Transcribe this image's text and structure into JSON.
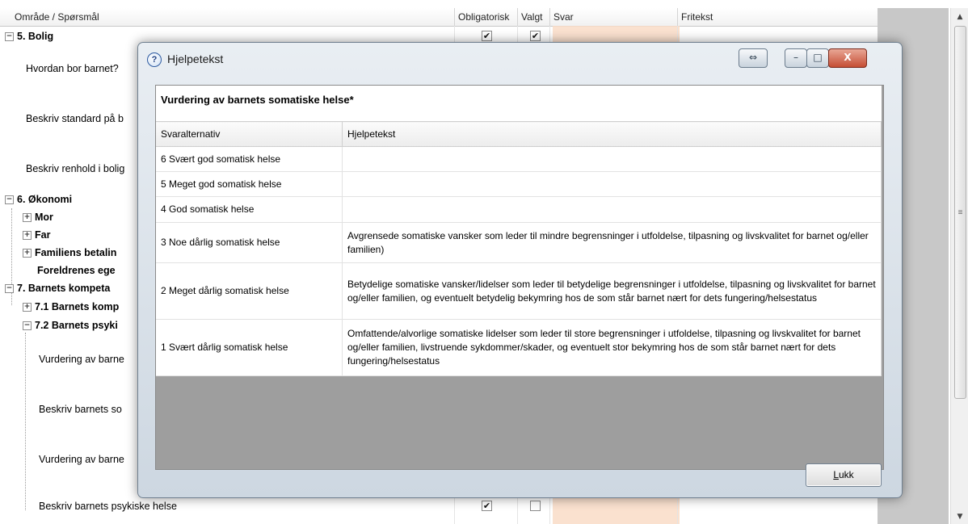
{
  "grid": {
    "columns": [
      "Område / Spørsmål",
      "Obligatorisk",
      "Valgt",
      "Svar",
      "Fritekst"
    ],
    "rows": [
      {
        "label": "5. Bolig",
        "bold": true,
        "toggle": "−"
      },
      {
        "label": "Hvordan bor barnet?"
      },
      {
        "label": "Beskriv standard på b"
      },
      {
        "label": "Beskriv renhold i bolig"
      },
      {
        "label": "6. Økonomi",
        "bold": true,
        "toggle": "−"
      },
      {
        "label": "Mor",
        "bold": true,
        "toggle": "+"
      },
      {
        "label": "Far",
        "bold": true,
        "toggle": "+"
      },
      {
        "label": "Familiens betalin",
        "bold": true,
        "toggle": "+"
      },
      {
        "label": "Foreldrenes ege",
        "bold": true
      },
      {
        "label": "7. Barnets kompeta",
        "bold": true,
        "toggle": "−"
      },
      {
        "label": "7.1 Barnets komp",
        "bold": true,
        "toggle": "+"
      },
      {
        "label": "7.2 Barnets psyki",
        "bold": true,
        "toggle": "−"
      },
      {
        "label": "Vurdering av barne"
      },
      {
        "label": "Beskriv barnets so"
      },
      {
        "label": "Vurdering av barne"
      },
      {
        "label": "Beskriv barnets psykiske helse"
      }
    ]
  },
  "dialog": {
    "title": "Hjelpetekst",
    "heading": "Vurdering av barnets somatiske helse*",
    "table_headers": [
      "Svaralternativ",
      "Hjelpetekst"
    ],
    "table_rows": [
      {
        "option": "6 Svært god somatisk helse",
        "help": ""
      },
      {
        "option": "5 Meget god somatisk helse",
        "help": ""
      },
      {
        "option": "4 God somatisk helse",
        "help": ""
      },
      {
        "option": "3 Noe dårlig somatisk helse",
        "help": "Avgrensede somatiske vansker som leder til mindre begrensninger i utfoldelse, tilpasning og livskvalitet for barnet og/eller familien)"
      },
      {
        "option": "2 Meget dårlig somatisk helse",
        "help": "Betydelige somatiske vansker/lidelser som leder til betydelige begrensninger i utfoldelse, tilpasning og livskvalitet for barnet og/eller familien, og eventuelt betydelig bekymring hos de som står barnet nært for dets fungering/helsestatus"
      },
      {
        "option": "1 Svært dårlig somatisk helse",
        "help": "Omfattende/alvorlige somatiske lidelser som leder til store begrensninger i utfoldelse, tilpasning og livskvalitet for barnet og/eller familien, livstruende sykdommer/skader, og eventuelt stor bekymring hos de som står barnet nært for dets fungering/helsestatus"
      }
    ],
    "close_label": "Lukk",
    "close_mnemonic": "L",
    "close_rest": "ukk",
    "icons": {
      "help": "question-icon",
      "restore": "resize-icon",
      "minimize": "minimize-icon",
      "maximize": "maximize-icon",
      "close": "close-icon"
    }
  },
  "colors": {
    "svar_band": "#f9dcc7",
    "dialog_frame": "#cdd7e1",
    "content_bg": "#9e9e9e"
  }
}
